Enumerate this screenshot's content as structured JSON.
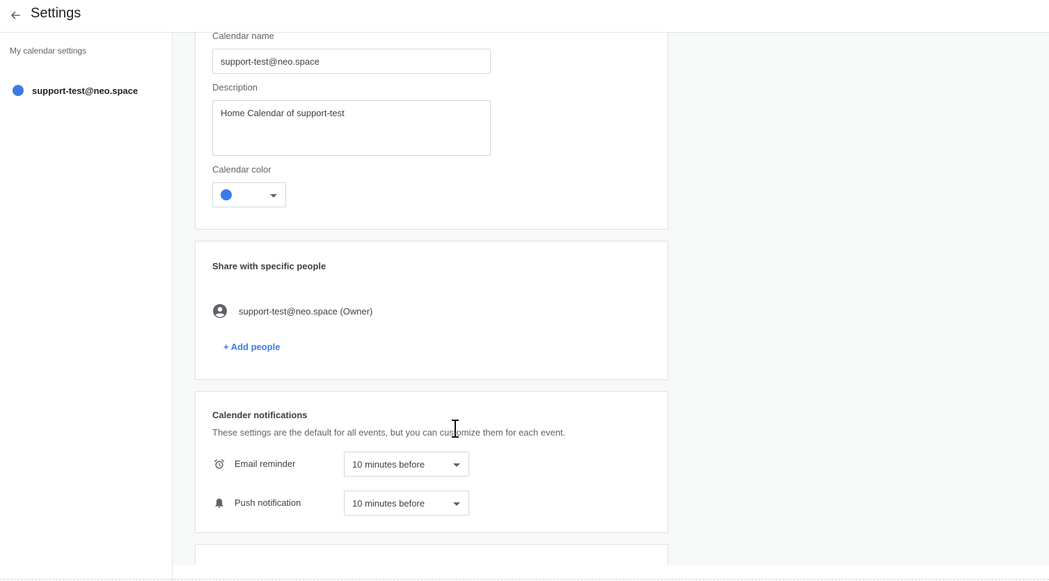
{
  "header": {
    "title": "Settings",
    "back_icon": "arrow-left-icon"
  },
  "sidebar": {
    "heading": "My calendar settings",
    "items": [
      {
        "label": "support-test@neo.space",
        "color": "#3a7be6"
      }
    ]
  },
  "calendar_settings": {
    "name_label": "Calendar name",
    "name_value": "support-test@neo.space",
    "description_label": "Description",
    "description_value": "Home Calendar of support-test",
    "color_label": "Calendar color",
    "color_value": "#3a7be6"
  },
  "sharing": {
    "title": "Share with specific people",
    "owner": "support-test@neo.space (Owner)",
    "add_people_label": "+ Add people"
  },
  "notifications": {
    "title": "Calender notifications",
    "description": "These settings are the default for all events, but you can customize them for each event.",
    "email_label": "Email reminder",
    "email_value": "10 minutes before",
    "push_label": "Push notification",
    "push_value": "10 minutes before"
  },
  "colors": {
    "accent": "#3a7be6",
    "background": "#f7f8f8"
  }
}
